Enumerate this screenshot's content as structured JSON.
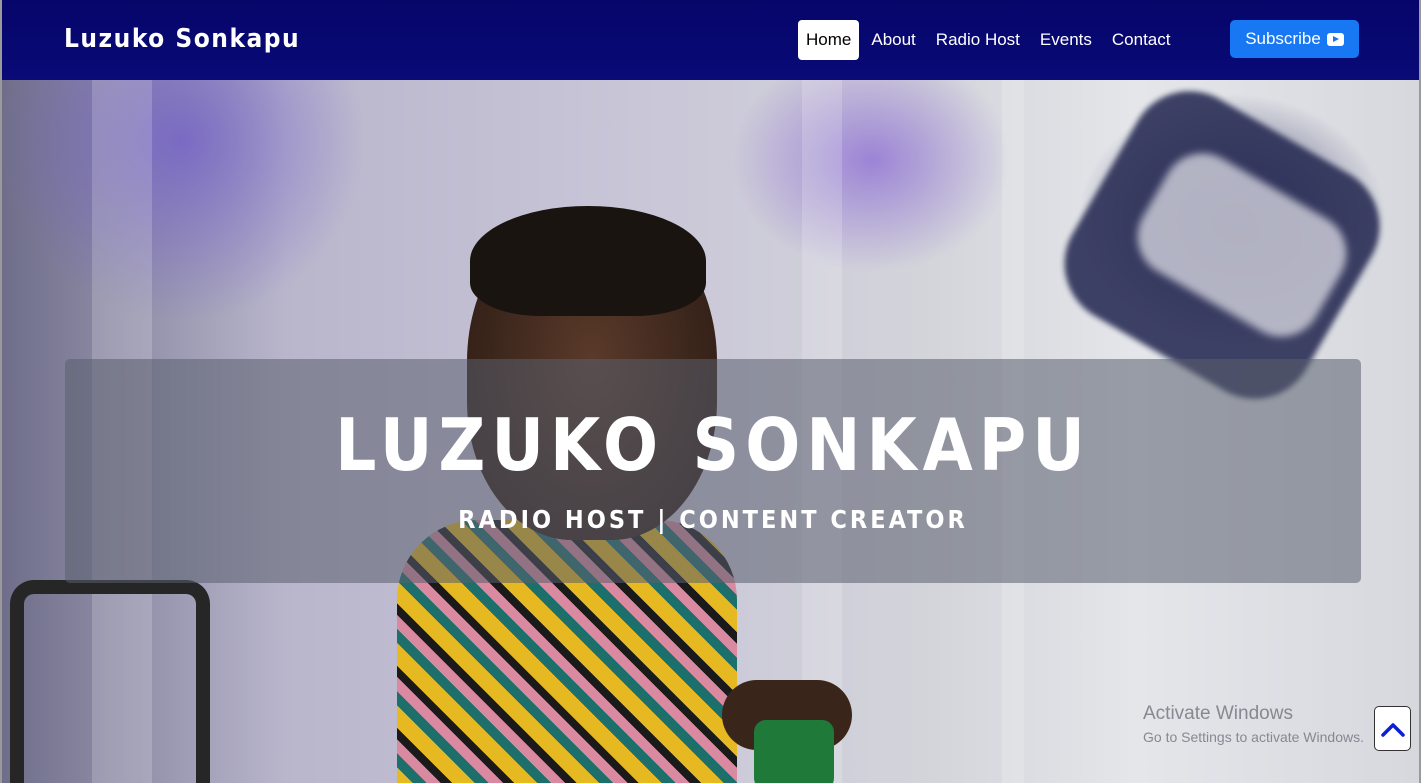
{
  "navbar": {
    "brand": "Luzuko Sonkapu",
    "links": [
      {
        "label": "Home",
        "active": true
      },
      {
        "label": "About",
        "active": false
      },
      {
        "label": "Radio Host",
        "active": false
      },
      {
        "label": "Events",
        "active": false
      },
      {
        "label": "Contact",
        "active": false
      }
    ],
    "subscribe_label": "Subscribe",
    "subscribe_icon": "youtube-icon"
  },
  "hero": {
    "title": "LUZUKO SONKAPU",
    "subtitle": "RADIO HOST | CONTENT CREATOR"
  },
  "watermark": {
    "title": "Activate Windows",
    "subtitle": "Go to Settings to activate Windows."
  },
  "scroll_top_icon": "chevron-up-icon",
  "colors": {
    "navbar": "#05056a",
    "subscribe": "#1877f2"
  }
}
